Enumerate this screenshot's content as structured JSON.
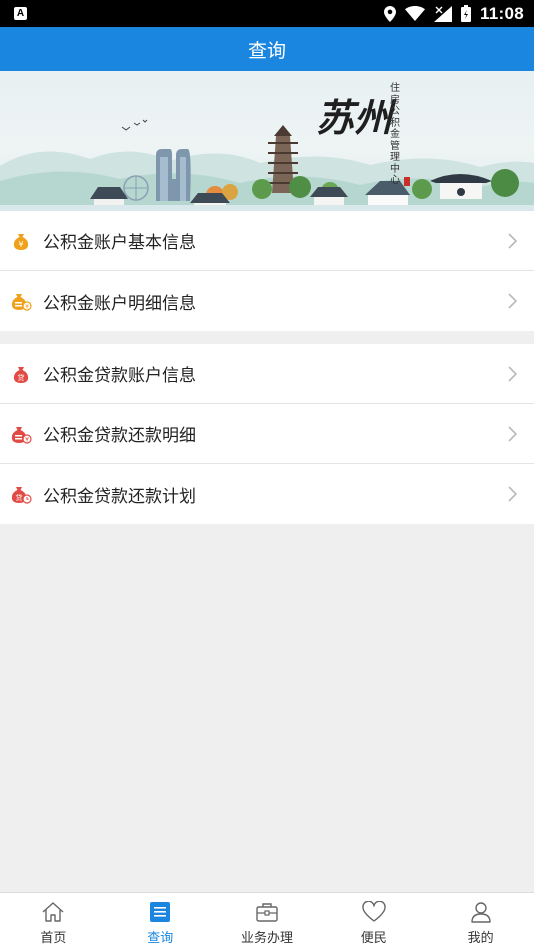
{
  "status_bar": {
    "time": "11:08",
    "notification_icon": "a-notification-icon",
    "icons": [
      "location-icon",
      "wifi-icon",
      "signal-icon",
      "battery-icon"
    ]
  },
  "header": {
    "title": "查询"
  },
  "banner": {
    "calligraphy": "苏州",
    "subtitle": "住房公积金管理中心"
  },
  "groups": [
    {
      "items": [
        {
          "label": "公积金账户基本信息",
          "icon": "coin-bag-icon",
          "icon_color": "#f0a11c"
        },
        {
          "label": "公积金账户明细信息",
          "icon": "coin-bag-detail-icon",
          "icon_color": "#f0a11c"
        }
      ]
    },
    {
      "items": [
        {
          "label": "公积金贷款账户信息",
          "icon": "loan-bag-icon",
          "icon_color": "#e24b45"
        },
        {
          "label": "公积金贷款还款明细",
          "icon": "loan-repay-detail-icon",
          "icon_color": "#e24b45"
        },
        {
          "label": "公积金贷款还款计划",
          "icon": "loan-repay-plan-icon",
          "icon_color": "#e24b45"
        }
      ]
    }
  ],
  "bottom_nav": {
    "items": [
      {
        "label": "首页",
        "icon": "home-icon",
        "active": false
      },
      {
        "label": "查询",
        "icon": "query-list-icon",
        "active": true
      },
      {
        "label": "业务办理",
        "icon": "briefcase-icon",
        "active": false
      },
      {
        "label": "便民",
        "icon": "heart-icon",
        "active": false
      },
      {
        "label": "我的",
        "icon": "person-icon",
        "active": false
      }
    ]
  },
  "colors": {
    "primary": "#1a86e0",
    "page_background": "#efefef",
    "coin_icon": "#f0a11c",
    "loan_icon": "#e24b45"
  }
}
